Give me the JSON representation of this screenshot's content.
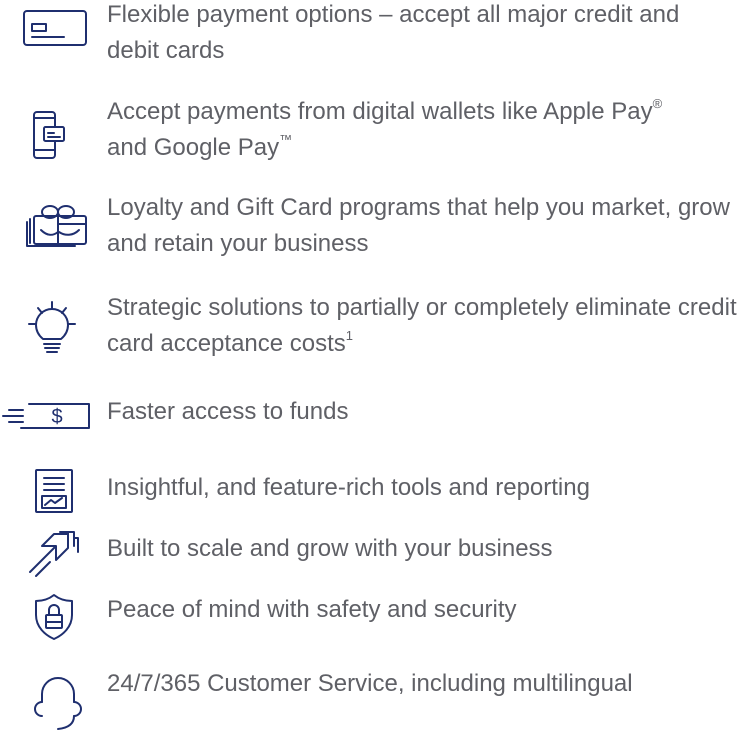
{
  "accent_color": "#1f2f6f",
  "text_color": "#5f6066",
  "features": [
    {
      "icon": "credit-card-icon",
      "text": "Flexible payment options – accept all major credit and debit cards",
      "sup": ""
    },
    {
      "icon": "digital-wallet-icon",
      "text": "Accept payments from digital wallets like Apple Pay",
      "sup": "®",
      "text_after": " and Google Pay",
      "sup_after": "™"
    },
    {
      "icon": "gift-card-icon",
      "text": "Loyalty and Gift Card programs that help you market, grow and retain your business",
      "sup": ""
    },
    {
      "icon": "lightbulb-icon",
      "text": "Strategic solutions to partially or completely eliminate credit card acceptance costs",
      "sup": "1"
    },
    {
      "icon": "fast-money-icon",
      "text": "Faster access to funds",
      "sup": ""
    },
    {
      "icon": "report-chart-icon",
      "text": "Insightful, and feature-rich tools and reporting",
      "sup": ""
    },
    {
      "icon": "growth-arrow-icon",
      "text": "Built to scale and grow with your business",
      "sup": ""
    },
    {
      "icon": "security-shield-icon",
      "text": "Peace of mind with safety and security",
      "sup": ""
    },
    {
      "icon": "headset-icon",
      "text": "24/7/365 Customer Service, including multilingual",
      "sup": ""
    }
  ]
}
